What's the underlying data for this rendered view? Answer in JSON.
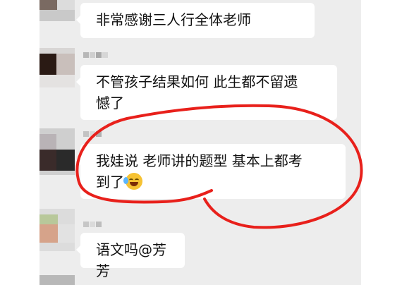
{
  "messages": [
    {
      "text": "非常感谢三人行全体老师"
    },
    {
      "text_line1": "不管孩子结果如何 此生都不留遗",
      "text_line2": "憾了"
    },
    {
      "text_line1": "我娃说 老师讲的题型 基本上都考",
      "text_line2": "到了",
      "emoji": "laughing-crying-emoji"
    },
    {
      "text": "语文吗@芳芳"
    }
  ],
  "colors": {
    "chat_background": "#ededed",
    "bubble": "#ffffff",
    "annotation": "#e8201b"
  }
}
